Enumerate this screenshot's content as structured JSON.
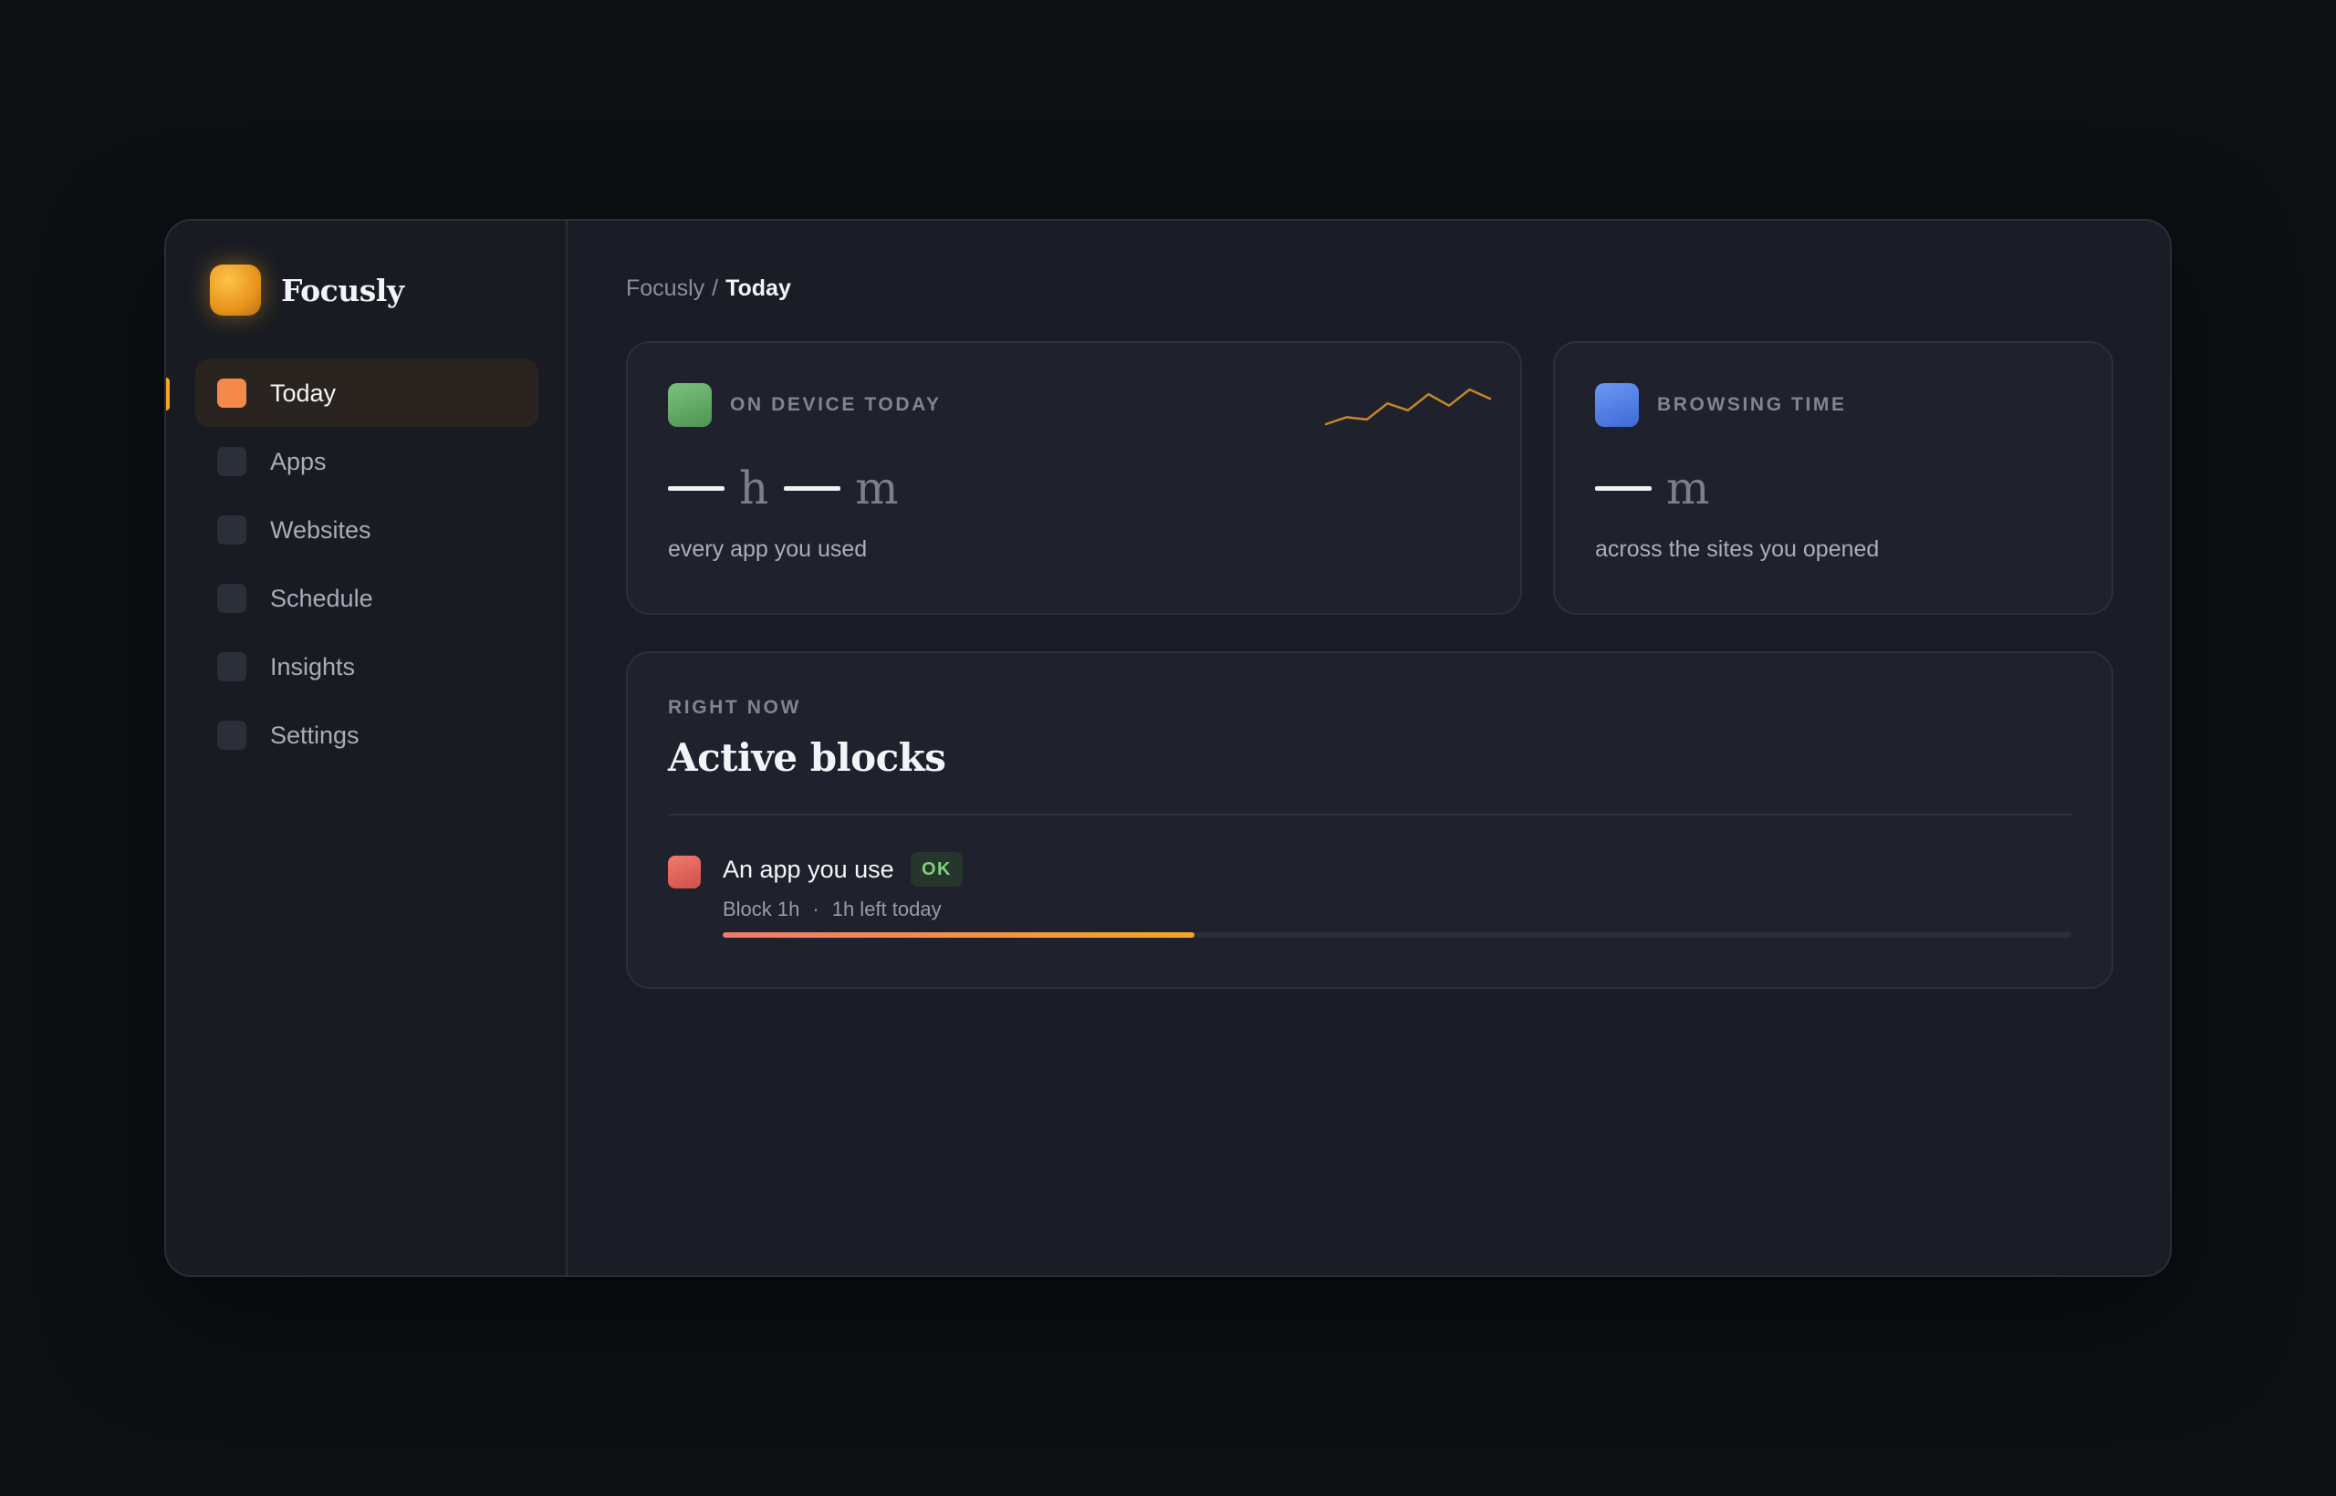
{
  "app": {
    "name": "Focusly",
    "logo_icon": "app-logo-icon"
  },
  "sidebar": {
    "items": [
      {
        "label": "Today",
        "icon": "today-icon",
        "active": true
      },
      {
        "label": "Apps",
        "icon": "apps-icon",
        "active": false
      },
      {
        "label": "Websites",
        "icon": "websites-icon",
        "active": false
      },
      {
        "label": "Schedule",
        "icon": "schedule-icon",
        "active": false
      },
      {
        "label": "Insights",
        "icon": "insights-icon",
        "active": false
      },
      {
        "label": "Settings",
        "icon": "settings-icon",
        "active": false
      }
    ]
  },
  "breadcrumb": {
    "root": "Focusly",
    "separator": "/",
    "current": "Today"
  },
  "stats": {
    "device": {
      "label": "ON DEVICE TODAY",
      "hours_unit": "h",
      "minutes_unit": "m",
      "caption": "every app you used",
      "icon_color": "#6bb26e",
      "sparkline": [
        2,
        5,
        4,
        11,
        8,
        15,
        10,
        17,
        13
      ],
      "sparkline_color": "#c8862a"
    },
    "browsing": {
      "label": "BROWSING TIME",
      "minutes_unit": "m",
      "caption": "across the sites you opened",
      "icon_color": "#5584e8"
    }
  },
  "blocks": {
    "eyebrow": "RIGHT NOW",
    "title": "Active blocks",
    "items": [
      {
        "name": "An app you use",
        "status": "OK",
        "rule": "Block 1h",
        "separator": "·",
        "remaining": "1h left today",
        "progress": 0.35,
        "icon_color": "#e5625a"
      }
    ]
  },
  "colors": {
    "accent": "#f5a623",
    "background": "#0d0f13",
    "card": "#1f222c"
  }
}
